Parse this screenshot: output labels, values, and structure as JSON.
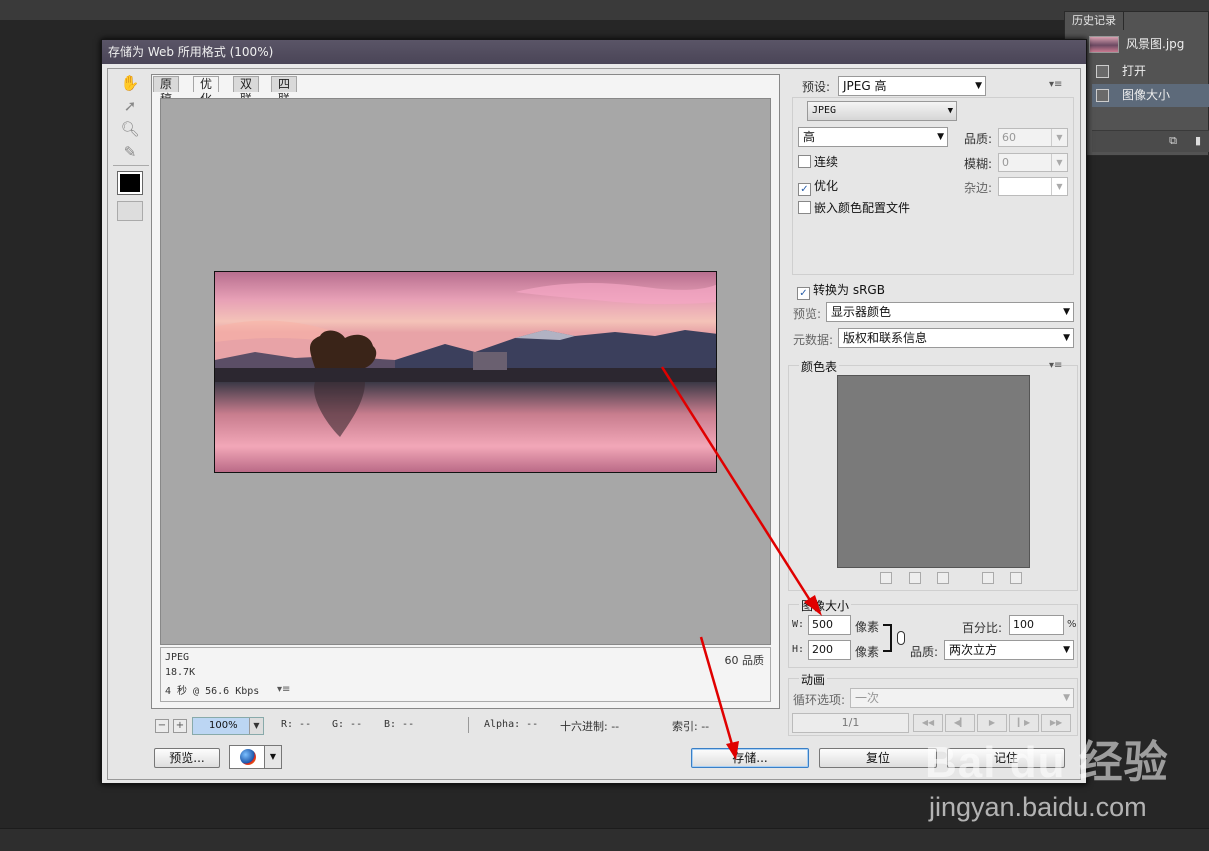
{
  "history_panel": {
    "tab": "历史记录",
    "items": [
      {
        "label": "风景图.jpg"
      },
      {
        "label": "打开"
      },
      {
        "label": "图像大小"
      }
    ]
  },
  "dialog": {
    "title": "存储为 Web 所用格式 (100%)",
    "tabs": [
      "原稿",
      "优化",
      "双联",
      "四联"
    ],
    "active_tab": "优化",
    "status": {
      "format": "JPEG",
      "size": "18.7K",
      "time": "4 秒 @ 56.6 Kbps",
      "quality": "60 品质"
    },
    "zoom": {
      "value": "100%",
      "r": "R: --",
      "g": "G: --",
      "b": "B: --",
      "alpha": "Alpha: --",
      "hex": "十六进制: --",
      "index": "索引: --"
    },
    "buttons": {
      "preview": "预览...",
      "save": "存储...",
      "reset": "复位",
      "remember": "记住"
    },
    "settings": {
      "preset_label": "预设:",
      "preset_value": "JPEG 高",
      "format_value": "JPEG",
      "quality_level": "高",
      "quality_label": "品质:",
      "quality_value": "60",
      "progressive_label": "连续",
      "progressive_checked": false,
      "blur_label": "模糊:",
      "blur_value": "0",
      "optimized_label": "优化",
      "optimized_checked": true,
      "matte_label": "杂边:",
      "embed_profile_label": "嵌入颜色配置文件",
      "embed_profile_checked": false,
      "convert_srgb_label": "转换为 sRGB",
      "convert_srgb_checked": true,
      "preview_label": "预览:",
      "preview_value": "显示器颜色",
      "metadata_label": "元数据:",
      "metadata_value": "版权和联系信息",
      "color_table_label": "颜色表",
      "image_size_label": "图像大小",
      "w_label": "W:",
      "w_value": "500",
      "h_label": "H:",
      "h_value": "200",
      "unit": "像素",
      "percent_label": "百分比:",
      "percent_value": "100",
      "percent_sign": "%",
      "resample_label": "品质:",
      "resample_value": "两次立方",
      "animation_label": "动画",
      "loop_label": "循环选项:",
      "loop_value": "一次",
      "frame_counter": "1/1"
    }
  },
  "watermark": {
    "logo": "Bai du 经验",
    "url": "jingyan.baidu.com"
  },
  "colors": {
    "arrow": "#e00000",
    "canvas_bg": "#a7a7a7"
  }
}
